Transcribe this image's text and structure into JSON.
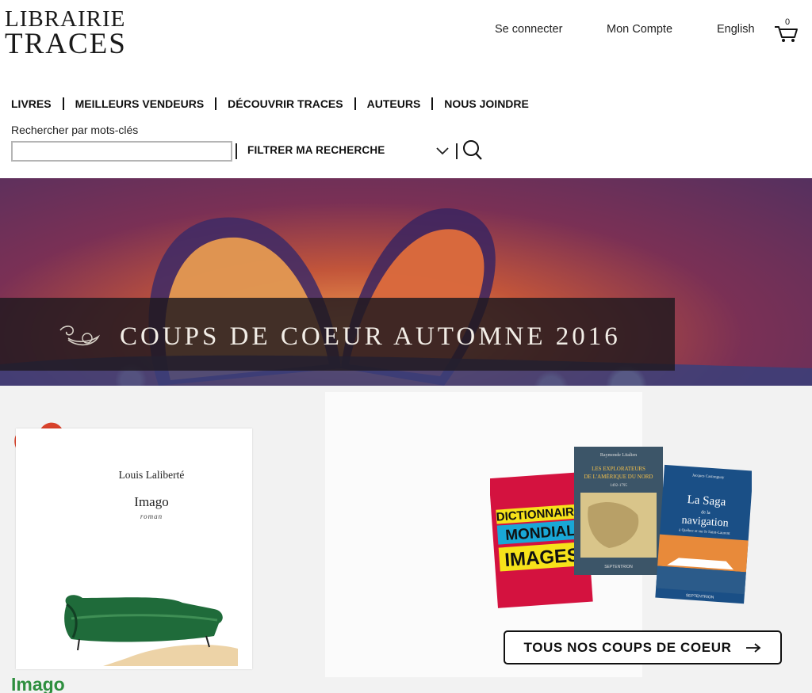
{
  "brand": {
    "line1": "LIBRAIRIE",
    "line2": "TRACES"
  },
  "header": {
    "login": "Se connecter",
    "account": "Mon Compte",
    "language": "English",
    "cart_count": "0"
  },
  "nav": {
    "items": [
      {
        "label": "LIVRES"
      },
      {
        "label": "MEILLEURS VENDEURS"
      },
      {
        "label": "DÉCOUVRIR TRACES"
      },
      {
        "label": "AUTEURS"
      },
      {
        "label": "NOUS JOINDRE"
      }
    ]
  },
  "search": {
    "label": "Rechercher par mots-clés",
    "value": "",
    "filter_label": "FILTRER MA RECHERCHE"
  },
  "banner": {
    "title": "COUPS DE COEUR AUTOMNE 2016"
  },
  "featured_book": {
    "author": "Louis Laliberté",
    "title": "Imago",
    "genre": "roman"
  },
  "book_covers": {
    "book1": {
      "lines": [
        "DICTIONNAIRE",
        "MONDIAL",
        "IMAGES"
      ]
    },
    "book2": {
      "author": "Raymonde Litalien",
      "title1": "LES EXPLORATEURS",
      "title2": "DE L'AMÉRIQUE DU NORD",
      "years": "1492-1795",
      "publisher": "SEPTENTRION"
    },
    "book3": {
      "author": "Jacques Castonguay",
      "title1": "La Saga",
      "title2": "de la",
      "title3": "navigation",
      "subtitle": "à Québec et sur le Saint-Laurent",
      "publisher": "SEPTENTRION"
    }
  },
  "cta": {
    "label": "TOUS NOS COUPS DE COEUR"
  },
  "product": {
    "title": "Imago"
  },
  "colors": {
    "accent_green": "#2f8f3f",
    "heart_red": "#d8422b"
  }
}
